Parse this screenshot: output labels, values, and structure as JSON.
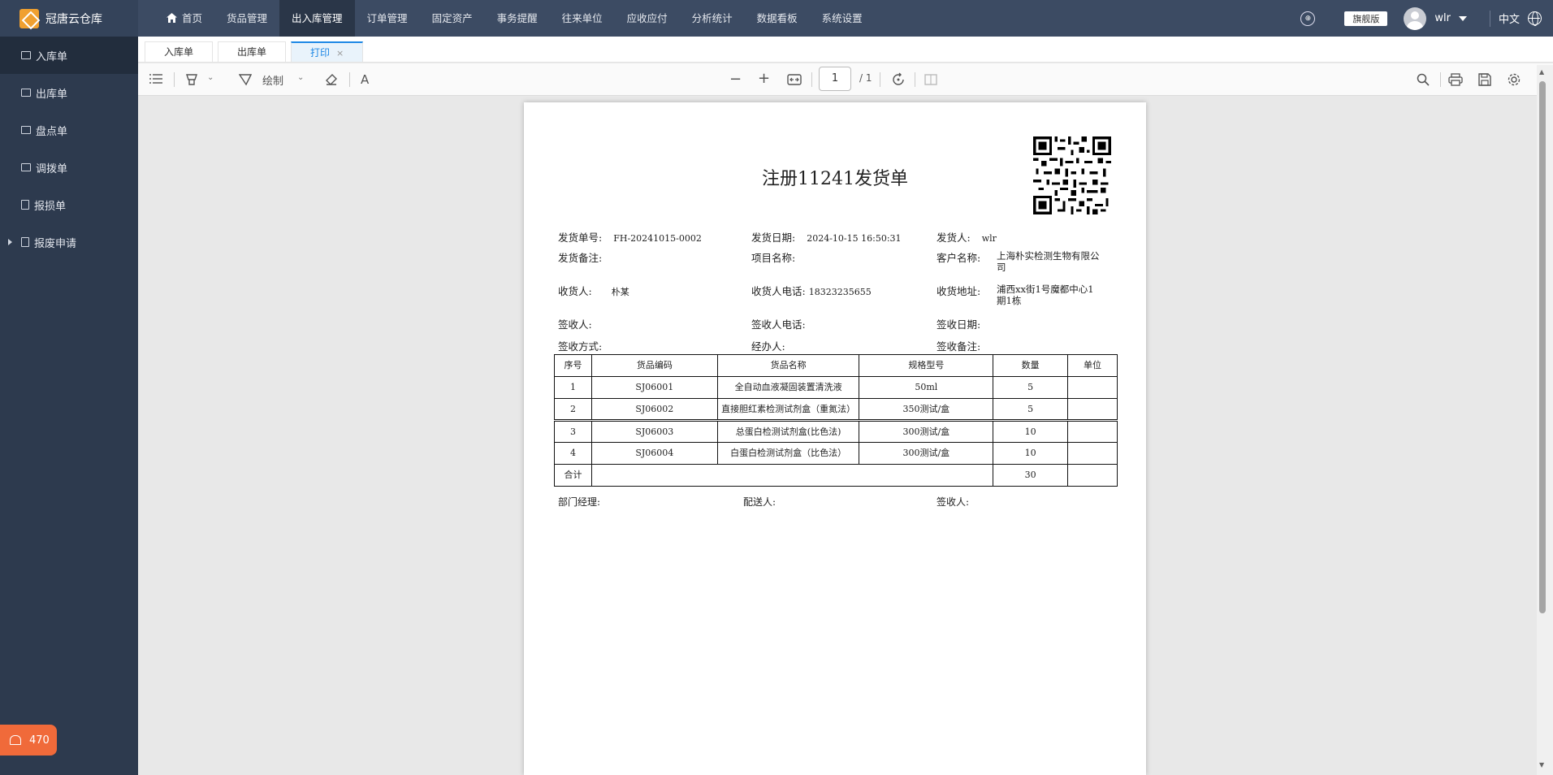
{
  "app": {
    "brand": "冠唐云仓库"
  },
  "topnav": {
    "items": [
      "首页",
      "货品管理",
      "出入库管理",
      "订单管理",
      "固定资产",
      "事务提醒",
      "往来单位",
      "应收应付",
      "分析统计",
      "数据看板",
      "系统设置"
    ],
    "active_index": 2,
    "edition": "旗舰版",
    "username": "wlr",
    "language": "中文"
  },
  "sidebar": {
    "items": [
      "入库单",
      "出库单",
      "盘点单",
      "调拨单",
      "报损单",
      "报废申请"
    ],
    "active_index": 0,
    "badge_count": "470"
  },
  "tabs": {
    "items": [
      "入库单",
      "出库单",
      "打印"
    ],
    "active_index": 2,
    "close_glyph": "×"
  },
  "pdf_toolbar": {
    "draw_label": "绘制",
    "text_tool": "A",
    "zoom_out": "−",
    "zoom_in": "+",
    "page_current": "1",
    "page_total": "/ 1"
  },
  "document": {
    "title": "注册11241发货单",
    "fields": {
      "ship_no_label": "发货单号:",
      "ship_no": "FH-20241015-0002",
      "ship_date_label": "发货日期:",
      "ship_date": "2024-10-15 16:50:31",
      "shipper_label": "发货人:",
      "shipper": "wlr",
      "ship_note_label": "发货备注:",
      "project_label": "项目名称:",
      "customer_label": "客户名称:",
      "customer": "上海朴实检测生物有限公司",
      "receiver_label": "收货人:",
      "receiver": "朴某",
      "receiver_phone_label": "收货人电话:",
      "receiver_phone": "18323235655",
      "address_label": "收货地址:",
      "address": "浦西xx街1号魔都中心1期1栋",
      "signer_label": "签收人:",
      "signer_phone_label": "签收人电话:",
      "sign_date_label": "签收日期:",
      "sign_method_label": "签收方式:",
      "handler_label": "经办人:",
      "sign_note_label": "签收备注:"
    },
    "table": {
      "headers": [
        "序号",
        "货品编码",
        "货品名称",
        "规格型号",
        "数量",
        "单位"
      ],
      "rows": [
        [
          "1",
          "SJ06001",
          "全自动血液凝固装置清洗液",
          "50ml",
          "5",
          ""
        ],
        [
          "2",
          "SJ06002",
          "直接胆红素检测试剂盒（重氮法）",
          "350测试/盒",
          "5",
          ""
        ],
        [
          "3",
          "SJ06003",
          "总蛋白检测试剂盒(比色法)",
          "300测试/盒",
          "10",
          ""
        ],
        [
          "4",
          "SJ06004",
          "白蛋白检测试剂盒（比色法）",
          "300测试/盒",
          "10",
          ""
        ]
      ],
      "total_label": "合计",
      "total_qty": "30"
    },
    "footer": {
      "dept_manager": "部门经理:",
      "courier": "配送人:",
      "signer": "签收人:"
    }
  }
}
